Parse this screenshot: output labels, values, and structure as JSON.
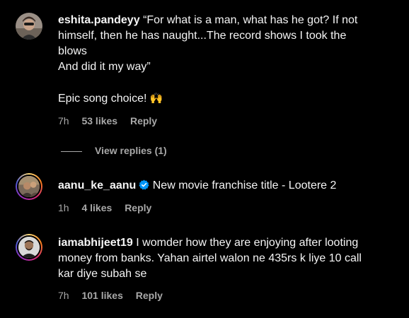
{
  "comments": [
    {
      "username": "eshita.pandeyy",
      "text_lines": [
        "“For what is a man, what has he got? If not",
        "himself, then he has naught...The record shows I took the",
        "blows",
        "And did it my way”",
        "",
        "Epic song choice!"
      ],
      "emoji": "🙌",
      "time": "7h",
      "likes": "53 likes",
      "reply": "Reply",
      "view_replies": "View replies (1)"
    },
    {
      "username": "aanu_ke_aanu",
      "verified": true,
      "text": "New movie franchise title - Lootere 2",
      "time": "1h",
      "likes": "4 likes",
      "reply": "Reply"
    },
    {
      "username": "iamabhijeet19",
      "text_lines": [
        "I womder how they are enjoying after looting",
        "money from banks. Yahan airtel walon ne 435rs k liye 10 call",
        "kar diye subah se"
      ],
      "time": "7h",
      "likes": "101 likes",
      "reply": "Reply"
    }
  ],
  "colors": {
    "background": "#000000",
    "text": "#f5f5f5",
    "secondary": "#a8a8a8",
    "verified": "#0095f6"
  }
}
